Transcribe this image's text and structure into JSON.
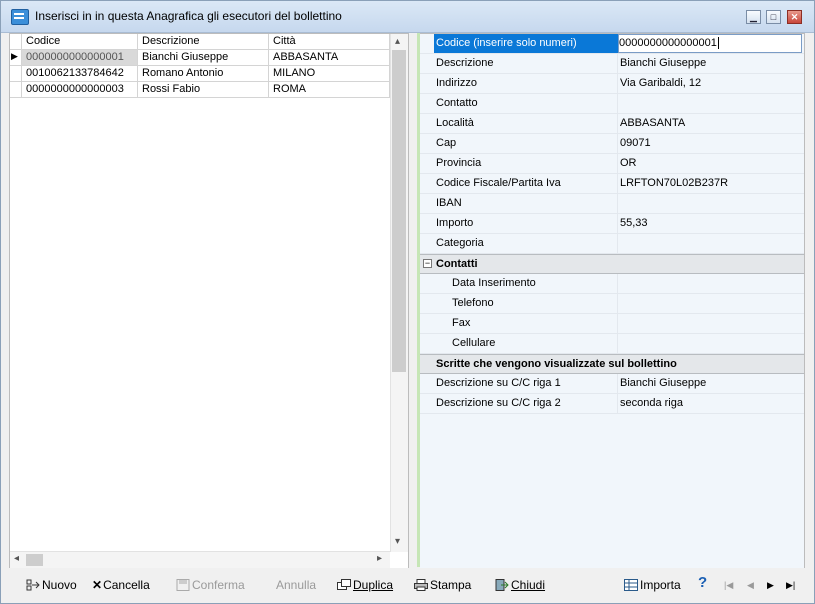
{
  "window": {
    "title": "Inserisci in in questa Anagrafica gli esecutori del bollettino",
    "btn_min": "▭",
    "btn_max": "□",
    "btn_close": "✕"
  },
  "grid": {
    "columns": [
      "Codice",
      "Descrizione",
      "Città"
    ],
    "rows": [
      {
        "codice": "0000000000000001",
        "descrizione": "Bianchi Giuseppe",
        "citta": "ABBASANTA",
        "current": true
      },
      {
        "codice": "0010062133784642",
        "descrizione": "Romano Antonio",
        "citta": "MILANO",
        "current": false
      },
      {
        "codice": "0000000000000003",
        "descrizione": "Rossi Fabio",
        "citta": "ROMA",
        "current": false
      }
    ],
    "row_marker": "▶"
  },
  "properties": {
    "main": [
      {
        "label": "Codice (inserire solo numeri)",
        "value": "0000000000000001"
      },
      {
        "label": "Descrizione",
        "value": "Bianchi Giuseppe"
      },
      {
        "label": "Indirizzo",
        "value": "Via Garibaldi, 12"
      },
      {
        "label": "Contatto",
        "value": ""
      },
      {
        "label": "Località",
        "value": "ABBASANTA"
      },
      {
        "label": "Cap",
        "value": "09071"
      },
      {
        "label": "Provincia",
        "value": "OR"
      },
      {
        "label": "Codice Fiscale/Partita Iva",
        "value": "LRFTON70L02B237R"
      },
      {
        "label": "IBAN",
        "value": ""
      },
      {
        "label": "Importo",
        "value": "55,33"
      },
      {
        "label": "Categoria",
        "value": ""
      }
    ],
    "contatti": {
      "title": "Contatti",
      "toggle": "−",
      "items": [
        {
          "label": "Data Inserimento",
          "value": ""
        },
        {
          "label": "Telefono",
          "value": ""
        },
        {
          "label": "Fax",
          "value": ""
        },
        {
          "label": "Cellulare",
          "value": ""
        }
      ]
    },
    "scritte": {
      "title": "Scritte che vengono visualizzate sul bollettino",
      "items": [
        {
          "label": "Descrizione su C/C riga 1",
          "value": "Bianchi Giuseppe"
        },
        {
          "label": "Descrizione su C/C riga 2",
          "value": "seconda riga"
        }
      ]
    }
  },
  "toolbar": {
    "nuovo": "Nuovo",
    "cancella": "Cancella",
    "conferma": "Conferma",
    "annulla": "Annulla",
    "duplica": "Duplica",
    "stampa": "Stampa",
    "chiudi": "Chiudi",
    "importa": "Importa",
    "help": "?",
    "nav_first": "|◀",
    "nav_prev": "◀",
    "nav_next": "▶",
    "nav_last": "▶|"
  }
}
